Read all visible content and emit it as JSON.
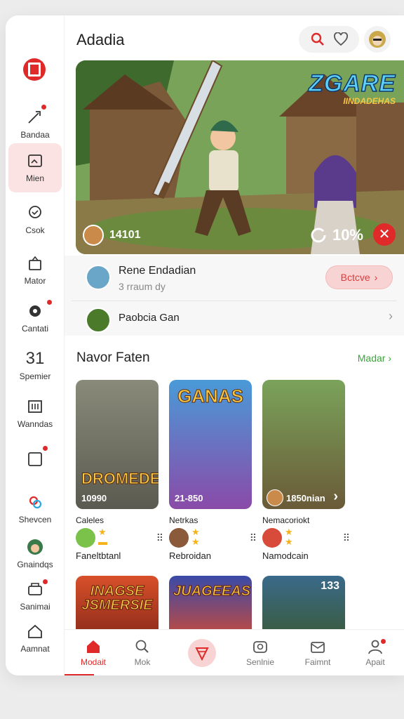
{
  "header": {
    "title": "Adadia"
  },
  "sidebar": {
    "items": [
      {
        "label": "Bandaa"
      },
      {
        "label": "Mien"
      },
      {
        "label": "Csok"
      },
      {
        "label": "Mator"
      },
      {
        "label": "Cantati"
      },
      {
        "label": "Spemier",
        "number": "31"
      },
      {
        "label": "Wanndas"
      },
      {
        "label": ""
      },
      {
        "label": "Shevcen"
      },
      {
        "label": "Gnaindqs"
      },
      {
        "label": "Sanimai"
      },
      {
        "label": "Aamnat"
      }
    ]
  },
  "hero": {
    "title": "ZGARE",
    "subtitle": "IINDADEHAS",
    "count": "14101",
    "percent": "10%"
  },
  "profile": {
    "name": "Rene Endadian",
    "sub": "3 rraum dy",
    "button": "Bctcve",
    "second_name": "Paobcia Gan"
  },
  "section": {
    "title": "Navor Faten",
    "more": "Madar"
  },
  "cards": [
    {
      "art": "DROMEDEA",
      "label": "10990",
      "name": "Caleles",
      "sub": "Faneltbtanl"
    },
    {
      "art": "GANAS",
      "label": "21-850",
      "name": "Netrkas",
      "sub": "Rebroidan"
    },
    {
      "art": "",
      "label": "1850nian",
      "name": "Nemacoriokt",
      "sub": "Namodcain"
    }
  ],
  "cards_row2": [
    {
      "art": "INAGSE JSMERSIE",
      "num": ""
    },
    {
      "art": "JUAGEEAS",
      "num": ""
    },
    {
      "art": "",
      "num": "133"
    }
  ],
  "bottom_nav": [
    {
      "label": "Modait"
    },
    {
      "label": "Mok"
    },
    {
      "label": ""
    },
    {
      "label": "Senlnie"
    },
    {
      "label": "Faimnt"
    },
    {
      "label": "Apait"
    }
  ],
  "colors": {
    "accent": "#e02a2a",
    "link_green": "#3aa43a",
    "active_bg": "#fbe3e3"
  }
}
